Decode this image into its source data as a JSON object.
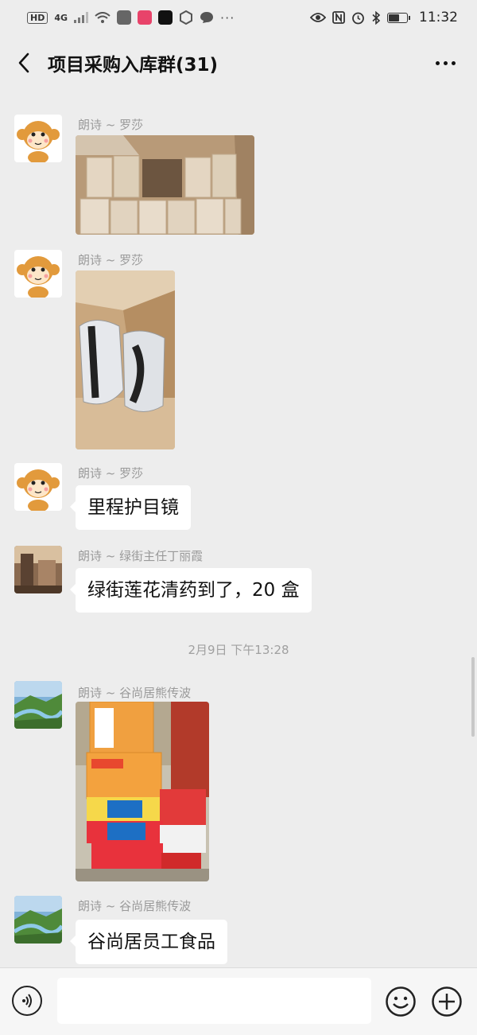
{
  "status_bar": {
    "network_label": "HD",
    "signal_label": "4G",
    "time": "11:32",
    "battery_level": 0.55
  },
  "header": {
    "title": "项目采购入库群(31)"
  },
  "messages": [
    {
      "sender": "朗诗 ~ 罗莎",
      "type": "image",
      "avatar": "monkey-avatar",
      "image": "boxes-of-cartons-photo"
    },
    {
      "sender": "朗诗 ~ 罗莎",
      "type": "image",
      "avatar": "monkey-avatar",
      "image": "goggles-in-box-photo"
    },
    {
      "sender": "朗诗 ~ 罗莎",
      "type": "text",
      "avatar": "monkey-avatar",
      "text": "里程护目镜"
    },
    {
      "sender": "朗诗 ~ 绿街主任丁丽霞",
      "type": "text",
      "avatar": "room-photo-avatar",
      "text": "绿街莲花清药到了，20 盒"
    },
    {
      "sender": "朗诗 ~ 谷尚居熊传波",
      "type": "image",
      "avatar": "landscape-avatar",
      "image": "food-boxes-photo"
    },
    {
      "sender": "朗诗 ~ 谷尚居熊传波",
      "type": "text",
      "avatar": "landscape-avatar",
      "text": "谷尚居员工食品"
    }
  ],
  "timestamp": "2月9日 下午13:28",
  "input_bar": {
    "value": "",
    "placeholder": ""
  },
  "colors": {
    "background": "#ededed",
    "bubble": "#ffffff",
    "sender_name": "#9a9a9a"
  }
}
